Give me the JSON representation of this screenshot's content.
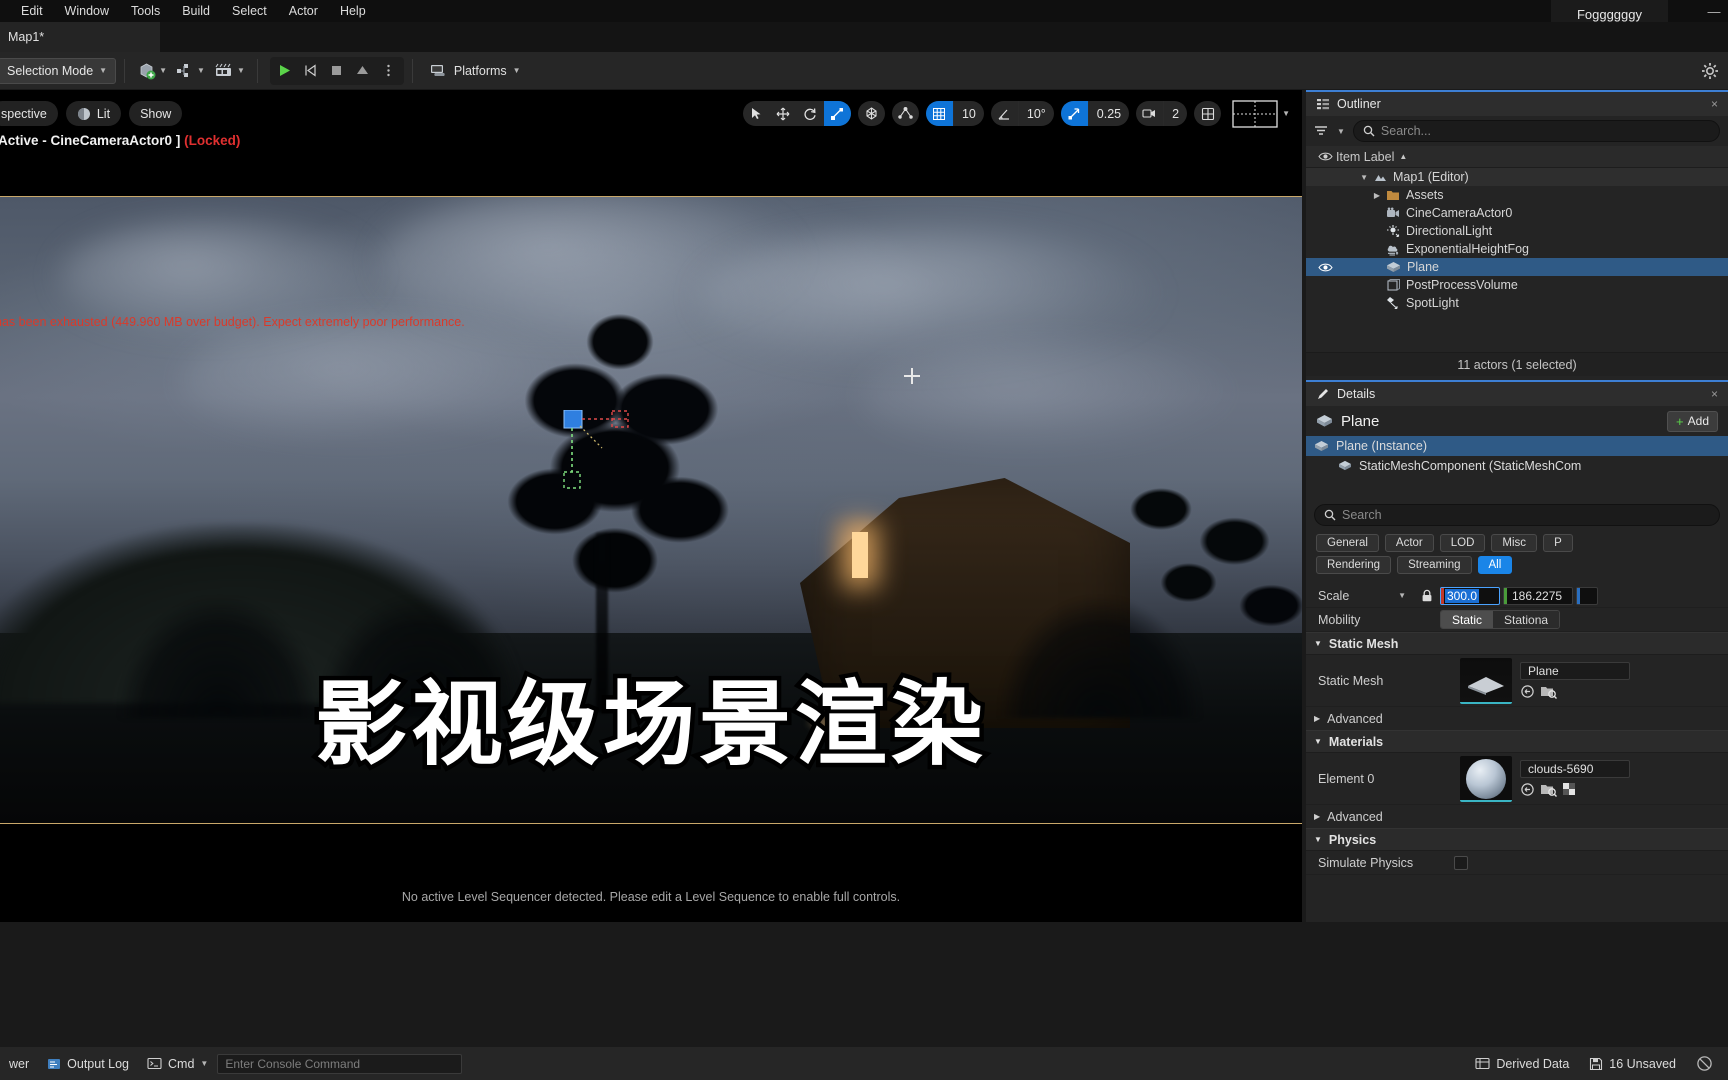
{
  "menubar": {
    "items": [
      "Edit",
      "Window",
      "Tools",
      "Build",
      "Select",
      "Actor",
      "Help"
    ],
    "user": "Foggggggy",
    "minimize": "—"
  },
  "tabbar": {
    "document_tab": "Map1*"
  },
  "toolbar": {
    "mode_label": "Selection Mode",
    "platforms_label": "Platforms",
    "icons": [
      "add-actor-icon",
      "blueprints-icon",
      "cinematics-icon",
      "play-icon",
      "skip-icon",
      "stop-icon",
      "eject-icon",
      "more-options-icon",
      "platforms-icon",
      "settings-gear-icon"
    ]
  },
  "viewport": {
    "perspective_label": "spective",
    "lit_label": "Lit",
    "show_label": "Show",
    "active_camera": "Active - CineCameraActor0 ]",
    "locked_label": "(Locked)",
    "warning": "has been exhausted (449.960 MB over budget). Expect extremely poor performance.",
    "grid_snap_value": "10",
    "angle_snap_value": "10°",
    "scale_snap_value": "0.25",
    "camera_speed_value": "2",
    "bottom_message": "No active Level Sequencer detected. Please edit a Level Sequence to enable full controls.",
    "overlay_title": "影视级场景渲染",
    "tools": [
      "select-tool-icon",
      "move-tool-icon",
      "rotate-tool-icon",
      "scale-tool-icon",
      "world-coordinate-icon",
      "surface-snap-icon",
      "grid-snap-icon",
      "angle-snap-icon",
      "scale-snap-icon",
      "camera-speed-icon",
      "viewport-options-icon",
      "layout-icon"
    ]
  },
  "outliner": {
    "tab_label": "Outliner",
    "close_label": "×",
    "search_placeholder": "Search...",
    "column_header": "Item Label",
    "sort_arrow": "▲",
    "items": [
      {
        "label": "Map1 (Editor)",
        "indent": 0,
        "icon": "level-icon",
        "expander": "▼",
        "selected": false,
        "visible": false
      },
      {
        "label": "Assets",
        "indent": 1,
        "icon": "folder-icon",
        "expander": "▶",
        "selected": false,
        "visible": false
      },
      {
        "label": "CineCameraActor0",
        "indent": 1,
        "icon": "camera-icon",
        "expander": "",
        "selected": false,
        "visible": false
      },
      {
        "label": "DirectionalLight",
        "indent": 1,
        "icon": "directional-light-icon",
        "expander": "",
        "selected": false,
        "visible": false
      },
      {
        "label": "ExponentialHeightFog",
        "indent": 1,
        "icon": "fog-icon",
        "expander": "",
        "selected": false,
        "visible": false
      },
      {
        "label": "Plane",
        "indent": 1,
        "icon": "mesh-icon",
        "expander": "",
        "selected": true,
        "visible": true
      },
      {
        "label": "PostProcessVolume",
        "indent": 1,
        "icon": "volume-icon",
        "expander": "",
        "selected": false,
        "visible": false
      },
      {
        "label": "SpotLight",
        "indent": 1,
        "icon": "spotlight-icon",
        "expander": "",
        "selected": false,
        "visible": false
      }
    ],
    "actor_count": "11 actors (1 selected)"
  },
  "details": {
    "tab_label": "Details",
    "close_label": "×",
    "object_name": "Plane",
    "add_label": "Add",
    "instance_label": "Plane (Instance)",
    "component_label": "StaticMeshComponent (StaticMeshCom",
    "search_placeholder": "Search",
    "filters_row1": [
      "General",
      "Actor",
      "LOD",
      "Misc",
      "P"
    ],
    "filters_row2": [
      "Rendering",
      "Streaming",
      "All"
    ],
    "active_filter": "All",
    "transform": {
      "scale_label": "Scale",
      "scale_x": "300.0",
      "scale_y": "186.2275",
      "lock_icon": "lock-icon"
    },
    "mobility": {
      "label": "Mobility",
      "options": [
        "Static",
        "Stationa"
      ],
      "selected": "Static"
    },
    "static_mesh_section": {
      "header": "Static Mesh",
      "row_label": "Static Mesh",
      "asset_name": "Plane",
      "advanced_label": "Advanced"
    },
    "materials_section": {
      "header": "Materials",
      "row_label": "Element 0",
      "asset_name": "clouds-5690",
      "advanced_label": "Advanced"
    },
    "physics_section": {
      "header": "Physics",
      "row_label": "Simulate Physics"
    }
  },
  "statusbar": {
    "content_drawer": "wer",
    "output_log": "Output Log",
    "cmd_label": "Cmd",
    "console_placeholder": "Enter Console Command",
    "derived_data": "Derived Data",
    "unsaved": "16 Unsaved"
  },
  "colors": {
    "accent_blue": "#1a85e8",
    "selection_blue": "#2f5a86",
    "warning_red": "#d93a2b",
    "locked_red": "#e03030",
    "panel_bg": "#242424",
    "toolbar_bg": "#262626"
  }
}
